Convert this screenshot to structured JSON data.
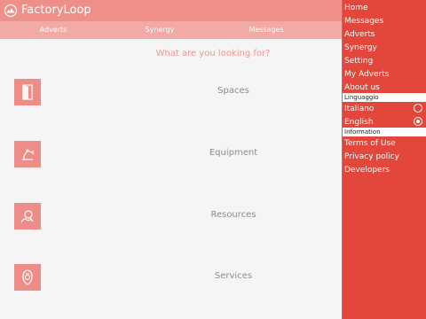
{
  "app": {
    "name": "FactoryLoop"
  },
  "tabs": [
    "Adverts",
    "Synergy",
    "Messages"
  ],
  "main": {
    "question": "What are you looking for?"
  },
  "categories": [
    {
      "label": "Spaces",
      "icon": "door-icon"
    },
    {
      "label": "Equipment",
      "icon": "robot-arm-icon"
    },
    {
      "label": "Resources",
      "icon": "resources-icon"
    },
    {
      "label": "Services",
      "icon": "services-icon"
    }
  ],
  "menu": {
    "items": [
      "Home",
      "Messages",
      "Adverts",
      "Synergy",
      "Setting",
      "My Adverts",
      "About us"
    ],
    "language_header": "Linguaggio",
    "languages": [
      {
        "label": "Italiano",
        "selected": false
      },
      {
        "label": "English",
        "selected": true
      }
    ],
    "info_header": "Information",
    "info_items": [
      "Terms of Use",
      "Privacy policy",
      "Developers"
    ]
  },
  "colors": {
    "accent": "#ef8f8a",
    "drawer": "#e3473c",
    "question": "#f19691"
  }
}
